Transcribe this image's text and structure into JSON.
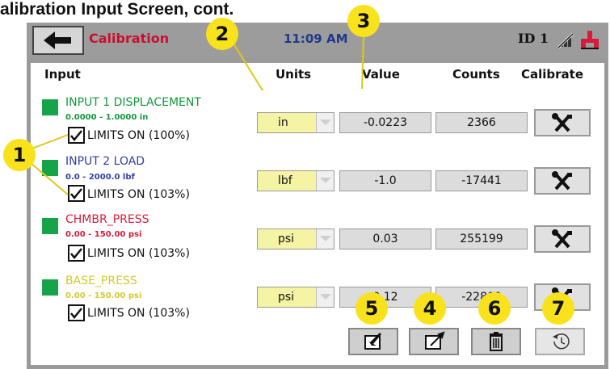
{
  "doc_title": "alibration Input Screen, cont.",
  "titlebar": {
    "title": "Calibration",
    "clock": "11:09 AM",
    "id_label": "ID 1"
  },
  "headers": {
    "input": "Input",
    "units": "Units",
    "value": "Value",
    "counts": "Counts",
    "calibrate": "Calibrate"
  },
  "inputs": [
    {
      "name": "INPUT 1 DISPLACEMENT",
      "range": "0.0000 - 1.0000 in",
      "name_color": "#0f9a3a",
      "range_color": "#0f9a3a",
      "limits": "LIMITS ON (100%)",
      "unit": "in",
      "value": "-0.0223",
      "counts": "2366"
    },
    {
      "name": "INPUT 2 LOAD",
      "range": "0.0 - 2000.0 lbf",
      "name_color": "#2f3fa6",
      "range_color": "#2f3fa6",
      "limits": "LIMITS ON (103%)",
      "unit": "lbf",
      "value": "-1.0",
      "counts": "-17441"
    },
    {
      "name": "CHMBR_PRESS",
      "range": "0.00 - 150.00 psi",
      "name_color": "#d81b3a",
      "range_color": "#d81b3a",
      "limits": "LIMITS ON (103%)",
      "unit": "psi",
      "value": "0.03",
      "counts": "255199"
    },
    {
      "name": "BASE_PRESS",
      "range": "0.00 - 150.00 psi",
      "name_color": "#d4c92a",
      "range_color": "#d4c92a",
      "limits": "LIMITS ON (103%)",
      "unit": "psi",
      "value": "0.12",
      "counts": "-22809"
    }
  ],
  "callouts": [
    "1",
    "2",
    "3",
    "4",
    "5",
    "6",
    "7"
  ],
  "colors": {
    "accent_red": "#c8102e",
    "clock_blue": "#1e3a8a",
    "status_green": "#17a34a",
    "unit_yellow": "#f4f4a4",
    "callout_yellow": "#f7e21c"
  },
  "icons": {
    "back": "arrow-left-icon",
    "no_connection": "no-connection-icon",
    "network": "network-icon",
    "calibrate": "wrench-screwdriver-icon",
    "import": "import-icon",
    "export": "export-icon",
    "delete": "trash-icon",
    "restore": "history-icon"
  }
}
